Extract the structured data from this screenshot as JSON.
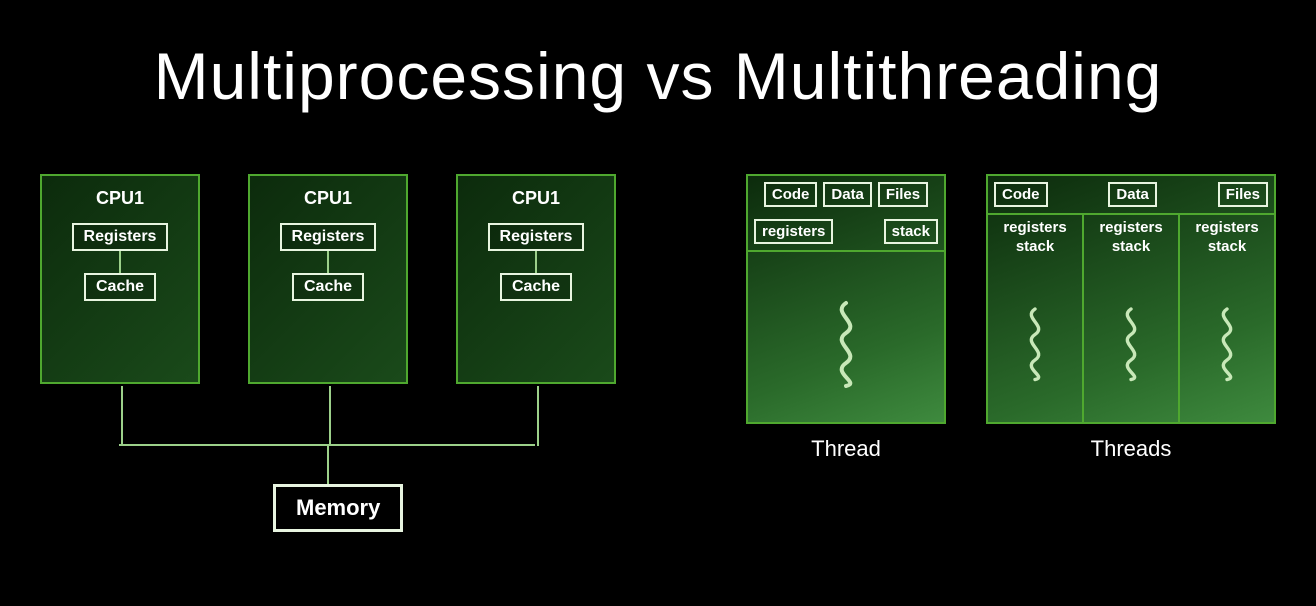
{
  "title": "Multiprocessing vs Multithreading",
  "multiprocessing": {
    "cpus": [
      {
        "name": "CPU1",
        "registers": "Registers",
        "cache": "Cache"
      },
      {
        "name": "CPU1",
        "registers": "Registers",
        "cache": "Cache"
      },
      {
        "name": "CPU1",
        "registers": "Registers",
        "cache": "Cache"
      }
    ],
    "shared_memory": "Memory"
  },
  "multithreading": {
    "single_thread": {
      "segments": [
        "Code",
        "Data",
        "Files"
      ],
      "state": [
        "registers",
        "stack"
      ],
      "caption": "Thread"
    },
    "multi_thread": {
      "segments": [
        "Code",
        "Data",
        "Files"
      ],
      "columns": [
        {
          "line1": "registers",
          "line2": "stack"
        },
        {
          "line1": "registers",
          "line2": "stack"
        },
        {
          "line1": "registers",
          "line2": "stack"
        }
      ],
      "caption": "Threads"
    }
  },
  "colors": {
    "background": "#000000",
    "box_border": "#4fa82f",
    "inner_border": "#e8f5e0",
    "squiggle": "#c8e8b8"
  }
}
